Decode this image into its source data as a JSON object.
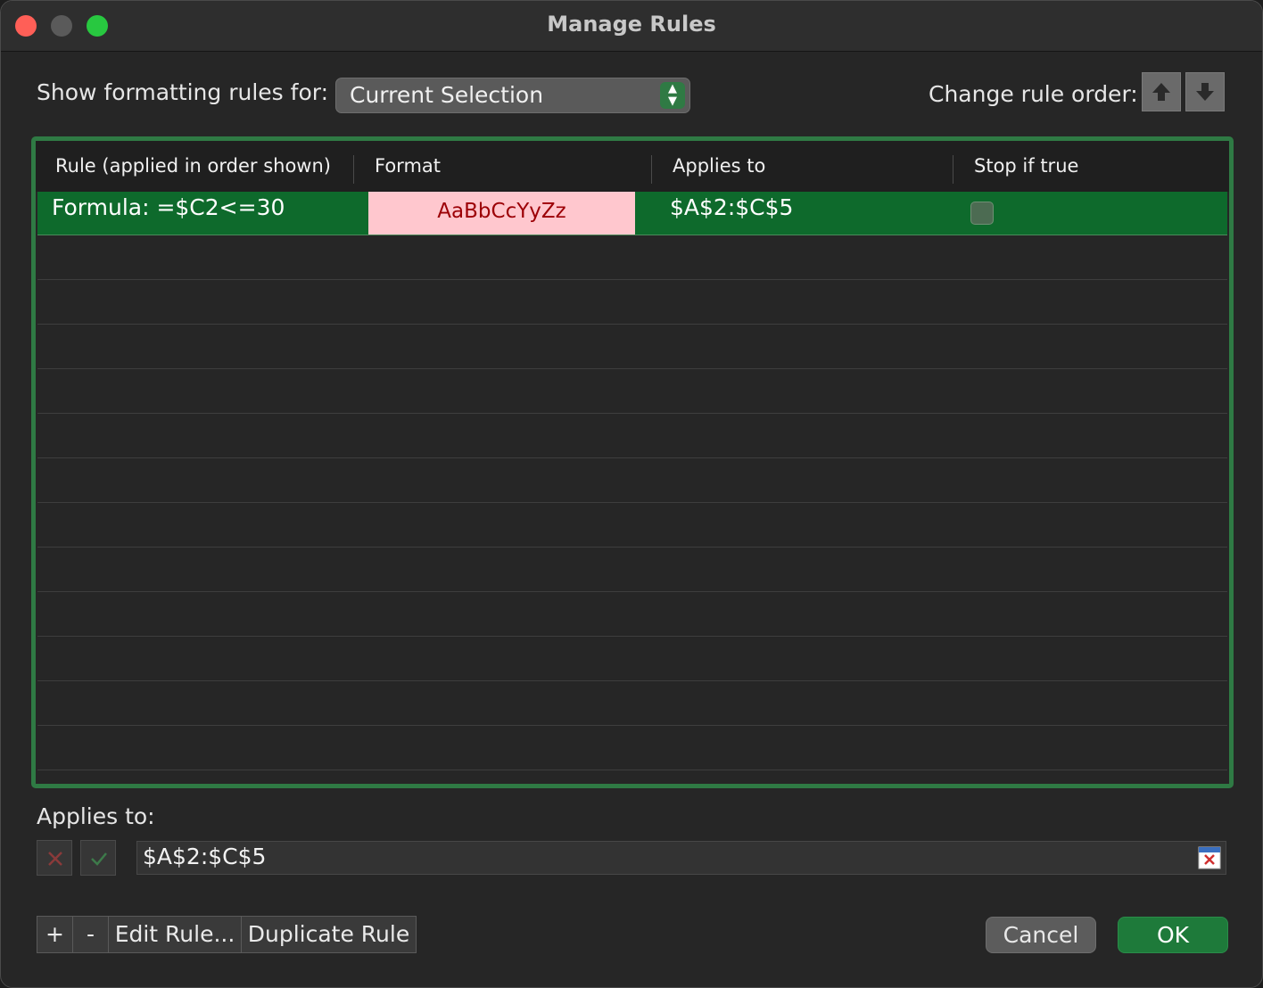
{
  "window": {
    "title": "Manage Rules"
  },
  "show_rules": {
    "label": "Show formatting rules for:",
    "selected": "Current Selection"
  },
  "rule_order": {
    "label": "Change rule order:",
    "up_icon": "arrow-up-icon",
    "down_icon": "arrow-down-icon"
  },
  "table": {
    "columns": [
      "Rule (applied in order shown)",
      "Format",
      "Applies to",
      "Stop if true"
    ],
    "rows": [
      {
        "rule": "Formula: =$C2<=30",
        "format_preview": "AaBbCcYyZz",
        "applies_to": "$A$2:$C$5",
        "stop_if_true": false
      }
    ]
  },
  "applies_to": {
    "label": "Applies to:",
    "value": "$A$2:$C$5"
  },
  "footer": {
    "add_label": "+",
    "remove_label": "-",
    "edit_label": "Edit Rule...",
    "duplicate_label": "Duplicate Rule",
    "cancel_label": "Cancel",
    "ok_label": "OK"
  },
  "colors": {
    "accent_green": "#2f7a44",
    "selected_row": "#0e6a2c",
    "format_fill": "#ffc7ce",
    "format_text": "#9c0006"
  }
}
